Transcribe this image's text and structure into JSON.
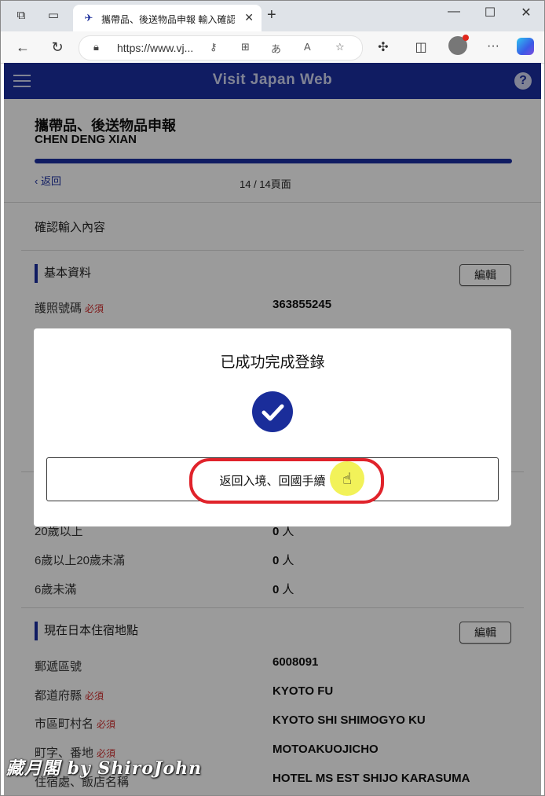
{
  "browser": {
    "tab_title": "攜帶品、後送物品申報 輸入確認",
    "url": "https://www.vj...",
    "icons": [
      "workspaces-icon",
      "tab-actions-icon",
      "favicon",
      "close-icon",
      "new-tab-icon",
      "minimize-icon",
      "maximize-icon",
      "window-close-icon",
      "back-icon",
      "refresh-icon",
      "lock-icon",
      "key-icon",
      "apps-icon",
      "translate-icon",
      "read-aloud-icon",
      "favorite-icon",
      "extensions-icon",
      "split-screen-icon",
      "profile-avatar",
      "more-icon",
      "copilot-icon"
    ]
  },
  "header": {
    "brand": "Visit Japan Web",
    "help": "?"
  },
  "page": {
    "title": "攜帶品、後送物品申報",
    "name": "CHEN DENG XIAN",
    "back": "返回",
    "page_number": "14 / 14頁面",
    "confirm_label": "確認輸入內容"
  },
  "sections": {
    "basic": {
      "title": "基本資料",
      "edit": "編輯",
      "rows": [
        {
          "label": "護照號碼",
          "required": "必須",
          "value": "363855245"
        }
      ]
    },
    "companions": {
      "rows": [
        {
          "label": "20歲以上",
          "value": "0",
          "unit": "人"
        },
        {
          "label": "6歲以上20歲未滿",
          "value": "0",
          "unit": "人"
        },
        {
          "label": "6歲未滿",
          "value": "0",
          "unit": "人"
        }
      ]
    },
    "address": {
      "title": "現在日本住宿地點",
      "edit": "編輯",
      "rows": [
        {
          "label": "郵遞區號",
          "required": "",
          "value": "6008091"
        },
        {
          "label": "都道府縣",
          "required": "必須",
          "value": "KYOTO FU"
        },
        {
          "label": "市區町村名",
          "required": "必須",
          "value": "KYOTO SHI SHIMOGYO KU"
        },
        {
          "label": "町字、番地",
          "required": "必須",
          "value": "MOTOAKUOJICHO"
        },
        {
          "label": "住宿處、飯店名稱",
          "required": "",
          "value": "HOTEL MS EST SHIJO KARASUMA"
        }
      ]
    }
  },
  "modal": {
    "title": "已成功完成登錄",
    "button": "返回入境、回國手續"
  },
  "watermark": "藏月閣 by ShiroJohn",
  "colors": {
    "brand_blue": "#1a2d9a",
    "required_red": "#c62828",
    "highlight_red": "#e0232b"
  }
}
